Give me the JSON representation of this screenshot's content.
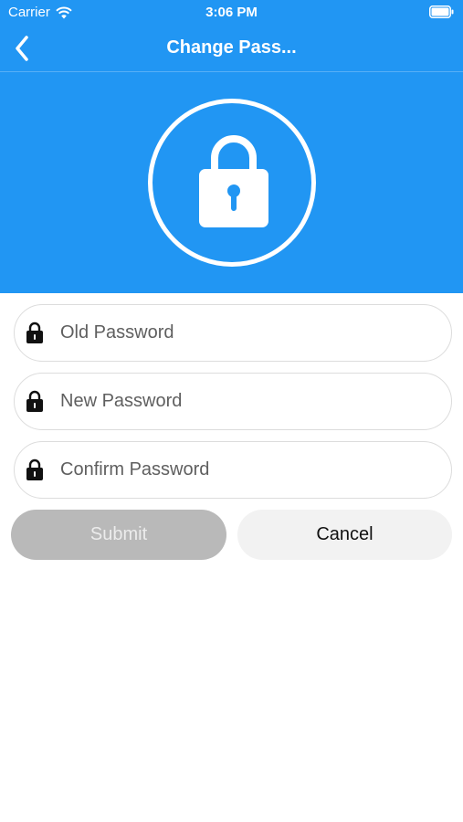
{
  "status_bar": {
    "carrier": "Carrier",
    "time": "3:06 PM",
    "wifi_icon": "wifi-icon",
    "battery_icon": "battery-icon"
  },
  "nav": {
    "title": "Change Pass...",
    "back_icon": "chevron-left-icon"
  },
  "header": {
    "icon": "lock-icon",
    "color": "#2196F3"
  },
  "form": {
    "old_password": {
      "placeholder": "Old Password",
      "value": "",
      "icon": "lock-icon"
    },
    "new_password": {
      "placeholder": "New Password",
      "value": "",
      "icon": "lock-icon"
    },
    "confirm_password": {
      "placeholder": "Confirm Password",
      "value": "",
      "icon": "lock-icon"
    }
  },
  "buttons": {
    "submit_label": "Submit",
    "cancel_label": "Cancel",
    "submit_color": "#B9B9B9",
    "cancel_color": "#F2F2F2"
  }
}
